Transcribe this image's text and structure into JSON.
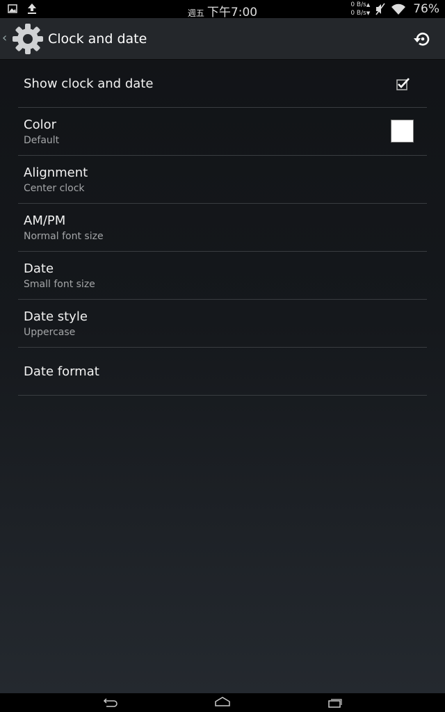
{
  "status_bar": {
    "day": "週五",
    "time": "下午7:00",
    "net_up": "0 B/s",
    "net_down": "0 B/s",
    "battery": "76%"
  },
  "action_bar": {
    "title": "Clock and date",
    "icons": [
      "settings-gear-icon",
      "reset-icon"
    ]
  },
  "settings": {
    "show_clock": {
      "title": "Show clock and date",
      "checked": true
    },
    "color": {
      "title": "Color",
      "summary": "Default",
      "swatch": "#ffffff"
    },
    "alignment": {
      "title": "Alignment",
      "summary": "Center clock"
    },
    "ampm": {
      "title": "AM/PM",
      "summary": "Normal font size"
    },
    "date": {
      "title": "Date",
      "summary": "Small font size"
    },
    "date_style": {
      "title": "Date style",
      "summary": "Uppercase"
    },
    "date_format": {
      "title": "Date format"
    }
  },
  "colors": {
    "status_bar_bg": "#000000",
    "action_bar_bg": "#24272b",
    "divider": "#3a3d41"
  }
}
